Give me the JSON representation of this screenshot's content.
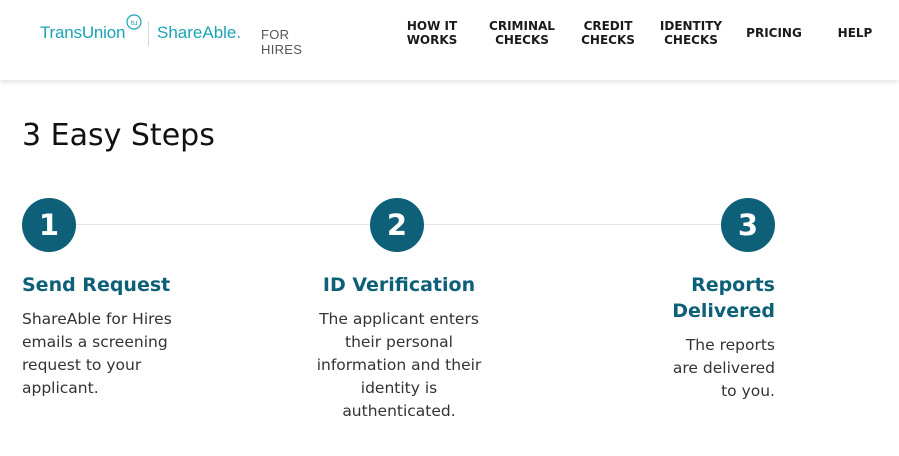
{
  "brand": {
    "company": "TransUnion",
    "company_mark": "tu",
    "product": "ShareAble.",
    "product_suffix": "FOR HIRES",
    "brand_color": "#1aa3b5"
  },
  "nav": {
    "items": [
      {
        "label": "HOW IT\nWORKS"
      },
      {
        "label": "CRIMINAL\nCHECKS"
      },
      {
        "label": "CREDIT\nCHECKS"
      },
      {
        "label": "IDENTITY\nCHECKS"
      },
      {
        "label": "PRICING"
      },
      {
        "label": "HELP"
      }
    ]
  },
  "main": {
    "title": "3 Easy Steps",
    "accent_color": "#0d6078",
    "steps": [
      {
        "number": "1",
        "title": "Send Request",
        "description": "ShareAble for Hires emails a screening request to your applicant."
      },
      {
        "number": "2",
        "title": "ID Verification",
        "description": "The applicant enters their personal information and their identity is authenticated."
      },
      {
        "number": "3",
        "title": "Reports Delivered",
        "description": "The reports are delivered to you."
      }
    ]
  }
}
